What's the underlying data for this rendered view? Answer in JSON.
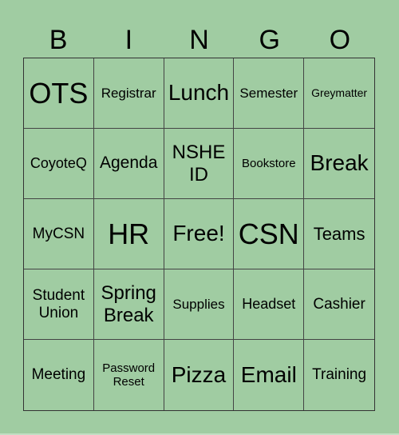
{
  "header": {
    "letters": [
      "B",
      "I",
      "N",
      "G",
      "O"
    ]
  },
  "board": {
    "cells": [
      "OTS",
      "Registrar",
      "Lunch",
      "Semester",
      "Greymatter",
      "CoyoteQ",
      "Agenda",
      "NSHE ID",
      "Bookstore",
      "Break",
      "MyCSN",
      "HR",
      "Free!",
      "CSN",
      "Teams",
      "Student Union",
      "Spring Break",
      "Supplies",
      "Headset",
      "Cashier",
      "Meeting",
      "Password Reset",
      "Pizza",
      "Email",
      "Training"
    ],
    "free_space_index": 12
  },
  "colors": {
    "background": "#a0cca2",
    "grid_line": "#333333",
    "text": "#000000"
  }
}
